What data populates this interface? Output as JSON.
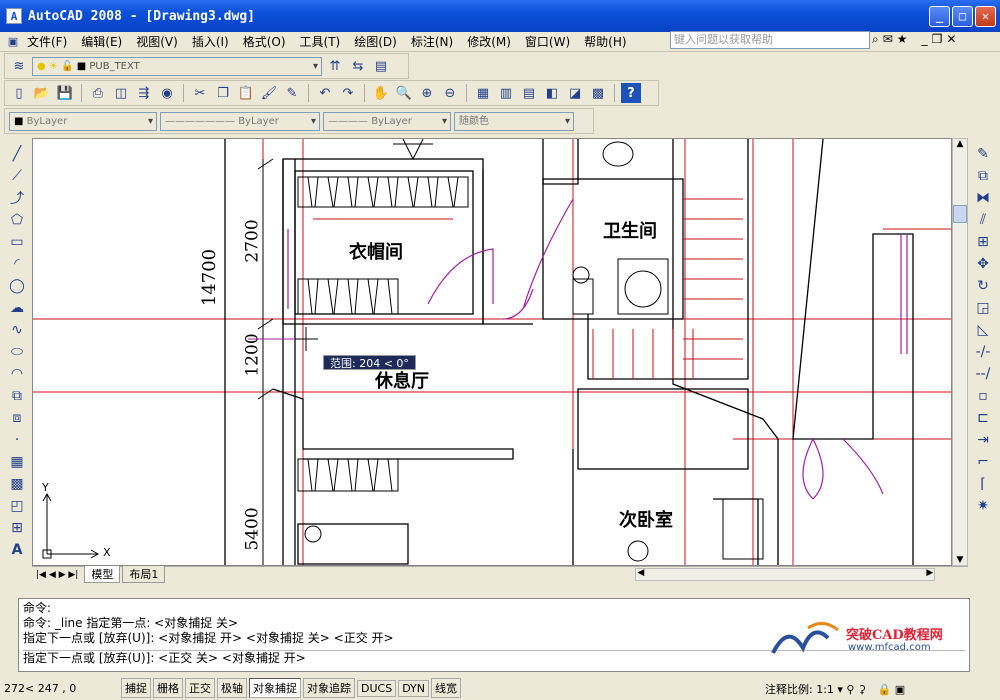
{
  "window": {
    "title": "AutoCAD 2008 - [Drawing3.dwg]",
    "app_icon": "A"
  },
  "menu": [
    "文件(F)",
    "编辑(E)",
    "视图(V)",
    "插入(I)",
    "格式(O)",
    "工具(T)",
    "绘图(D)",
    "标注(N)",
    "修改(M)",
    "窗口(W)",
    "帮助(H)"
  ],
  "help_placeholder": "键入问题以获取帮助",
  "layer": {
    "current": "PUB_TEXT"
  },
  "properties": {
    "color": "ByLayer",
    "linetype": "ByLayer",
    "lineweight": "ByLayer",
    "plotstyle": "随颜色"
  },
  "drawing": {
    "rooms": [
      "衣帽间",
      "卫生间",
      "休息厅",
      "次卧室"
    ],
    "dims": [
      "14700",
      "2700",
      "1200",
      "5400"
    ],
    "tooltip": "范围: 204 < 0°",
    "ucs": {
      "x": "X",
      "y": "Y"
    }
  },
  "tabs": [
    "模型",
    "布局1"
  ],
  "command": {
    "lines": [
      "命令:",
      "命令: _line 指定第一点: <对象捕捉 关>",
      "指定下一点或 [放弃(U)]: <对象捕捉 开> <对象捕捉 关> <正交 开>"
    ],
    "current": "指定下一点或 [放弃(U)]: <正交 关> <对象捕捉 开>"
  },
  "status": {
    "coords": "272< 247 , 0",
    "toggles": [
      "捕捉",
      "栅格",
      "正交",
      "极轴",
      "对象捕捉",
      "对象追踪",
      "DUCS",
      "DYN",
      "线宽"
    ],
    "active": "对象捕捉",
    "scale_label": "注释比例: 1:1"
  },
  "watermark": {
    "title": "突破CAD教程网",
    "url": "www.mfcad.com"
  },
  "colors": {
    "title": "#0a50d8",
    "wall": "#000000",
    "axis": "#c8101a",
    "door": "#a020a0"
  }
}
